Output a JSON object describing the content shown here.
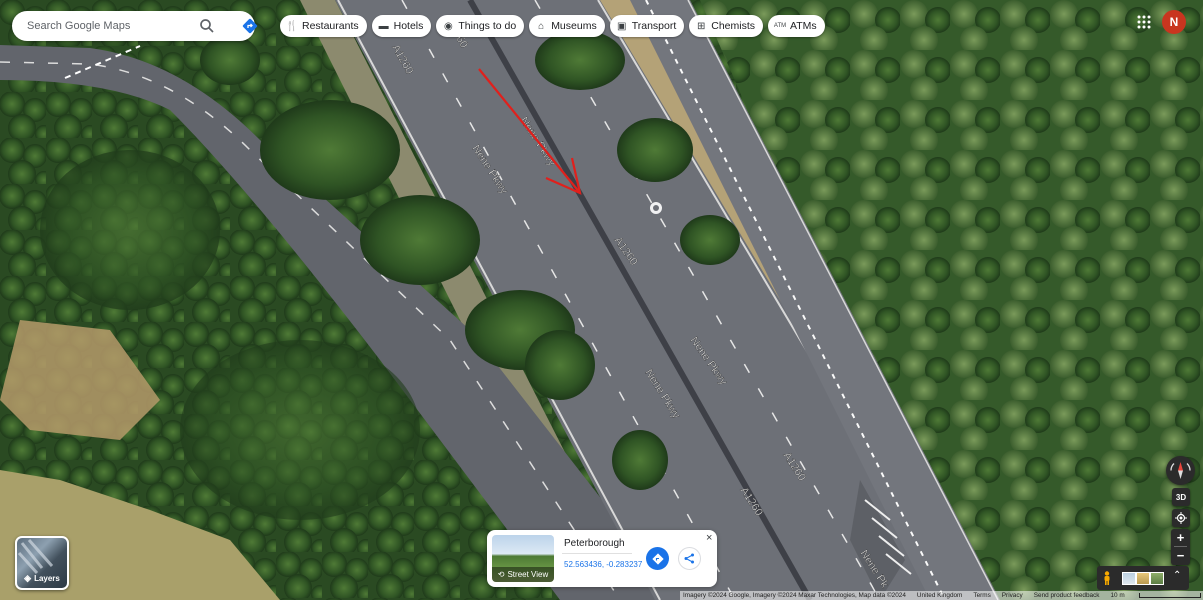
{
  "search": {
    "placeholder": "Search Google Maps"
  },
  "chips": [
    {
      "label": "Restaurants",
      "icon": "fork-knife-icon"
    },
    {
      "label": "Hotels",
      "icon": "bed-icon"
    },
    {
      "label": "Things to do",
      "icon": "camera-icon"
    },
    {
      "label": "Museums",
      "icon": "museum-icon"
    },
    {
      "label": "Transport",
      "icon": "train-icon"
    },
    {
      "label": "Chemists",
      "icon": "pharmacy-icon"
    },
    {
      "label": "ATMs",
      "icon": "atm-icon"
    }
  ],
  "account": {
    "avatar_letter": "N"
  },
  "map": {
    "road_labels": {
      "a1260_top": "A1260",
      "a1260_top2": "60",
      "nene_pkwy_1": "Nene Pkwy",
      "nene_pkwy_2": "Nene Pkwy",
      "a1260_mid": "A1260",
      "nene_pkwy_3": "Nene Pkwy",
      "nene_pkwy_4": "Nene Pkwy",
      "a1260_lower": "A1260",
      "a1260_lower2": "A1260",
      "nene_pkwy_5": "Nene Pk"
    },
    "annotation_color": "#e0201c"
  },
  "layers": {
    "label": "Layers"
  },
  "streetview_card": {
    "thumb_label": "Street View",
    "title": "Peterborough",
    "coords": "52.563436, -0.283237",
    "close": "×"
  },
  "controls": {
    "three_d": "3D",
    "zoom_in": "+",
    "zoom_out": "−"
  },
  "footer": {
    "imagery": "Imagery ©2024 Google, Imagery ©2024 Maxar Technologies, Map data ©2024",
    "region": "United Kingdom",
    "terms": "Terms",
    "privacy": "Privacy",
    "feedback": "Send product feedback",
    "scale": "10 m"
  }
}
